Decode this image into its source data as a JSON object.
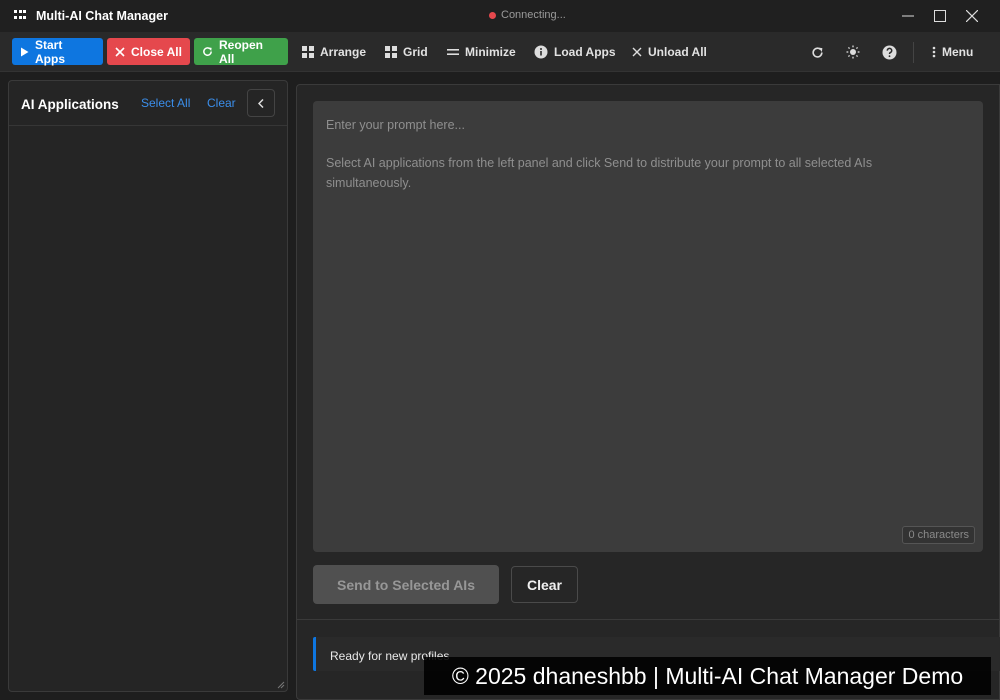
{
  "window": {
    "title": "Multi-AI Chat Manager",
    "status": "Connecting...",
    "status_color": "#e5484d"
  },
  "toolbar": {
    "start_apps": "Start Apps",
    "close_all": "Close All",
    "reopen_all": "Reopen All",
    "arrange": "Arrange",
    "grid": "Grid",
    "minimize": "Minimize",
    "load_apps": "Load Apps",
    "unload_all": "Unload All",
    "menu": "Menu"
  },
  "sidebar": {
    "title": "AI Applications",
    "select_all": "Select All",
    "clear": "Clear"
  },
  "main": {
    "prompt_placeholder": "Enter your prompt here...",
    "prompt_hint": "Select AI applications from the left panel and click Send to distribute your prompt to all selected AIs simultaneously.",
    "char_count": "0 characters",
    "send_button": "Send to Selected AIs",
    "clear_button": "Clear",
    "status_message": "Ready for new profiles"
  },
  "watermark": "© 2025 dhaneshbb | Multi-AI Chat Manager Demo",
  "colors": {
    "accent": "#0e76e0",
    "danger": "#e5484d",
    "success": "#3fa14a",
    "link": "#3b8eea"
  }
}
